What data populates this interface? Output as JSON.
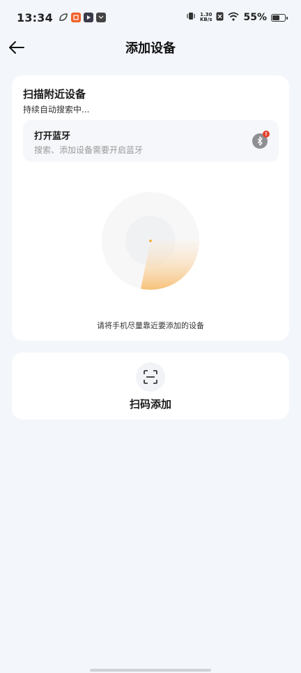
{
  "status_bar": {
    "time": "13:34",
    "net_speed_value": "1.30",
    "net_speed_unit": "KB/s",
    "battery_percent": "55%",
    "battery_level": 0.55
  },
  "header": {
    "title": "添加设备",
    "back_icon": "arrow-left-icon"
  },
  "scan": {
    "title": "扫描附近设备",
    "subtitle": "持续自动搜索中...",
    "bluetooth": {
      "title": "打开蓝牙",
      "description": "搜索、添加设备需要开启蓝牙",
      "icon": "bluetooth-icon",
      "badge": "!"
    },
    "hint": "请将手机尽量靠近要添加的设备"
  },
  "qr": {
    "label": "扫码添加",
    "icon": "scan-icon"
  },
  "colors": {
    "background": "#f3f6fa",
    "card": "#ffffff",
    "accent": "#f5a623",
    "badge": "#e8402f"
  }
}
